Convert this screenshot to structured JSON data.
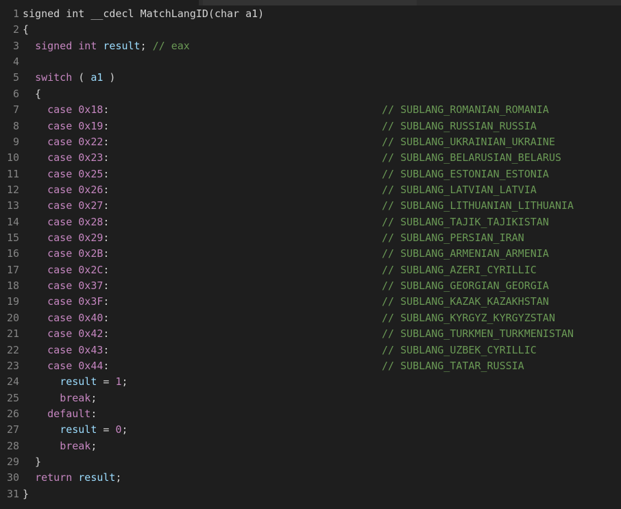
{
  "editor": {
    "lines": [
      {
        "n": "1",
        "code": "signed int __cdecl MatchLangID(char a1)",
        "comment": ""
      },
      {
        "n": "2",
        "code": "{",
        "comment": ""
      },
      {
        "n": "3",
        "code": "  signed int result; // eax",
        "comment": ""
      },
      {
        "n": "4",
        "code": "",
        "comment": ""
      },
      {
        "n": "5",
        "code": "  switch ( a1 )",
        "comment": ""
      },
      {
        "n": "6",
        "code": "  {",
        "comment": ""
      },
      {
        "n": "7",
        "code": "    case 0x18:",
        "comment": "// SUBLANG_ROMANIAN_ROMANIA"
      },
      {
        "n": "8",
        "code": "    case 0x19:",
        "comment": "// SUBLANG_RUSSIAN_RUSSIA"
      },
      {
        "n": "9",
        "code": "    case 0x22:",
        "comment": "// SUBLANG_UKRAINIAN_UKRAINE"
      },
      {
        "n": "10",
        "code": "    case 0x23:",
        "comment": "// SUBLANG_BELARUSIAN_BELARUS"
      },
      {
        "n": "11",
        "code": "    case 0x25:",
        "comment": "// SUBLANG_ESTONIAN_ESTONIA"
      },
      {
        "n": "12",
        "code": "    case 0x26:",
        "comment": "// SUBLANG_LATVIAN_LATVIA"
      },
      {
        "n": "13",
        "code": "    case 0x27:",
        "comment": "// SUBLANG_LITHUANIAN_LITHUANIA"
      },
      {
        "n": "14",
        "code": "    case 0x28:",
        "comment": "// SUBLANG_TAJIK_TAJIKISTAN"
      },
      {
        "n": "15",
        "code": "    case 0x29:",
        "comment": "// SUBLANG_PERSIAN_IRAN"
      },
      {
        "n": "16",
        "code": "    case 0x2B:",
        "comment": "// SUBLANG_ARMENIAN_ARMENIA"
      },
      {
        "n": "17",
        "code": "    case 0x2C:",
        "comment": "// SUBLANG_AZERI_CYRILLIC"
      },
      {
        "n": "18",
        "code": "    case 0x37:",
        "comment": "// SUBLANG_GEORGIAN_GEORGIA"
      },
      {
        "n": "19",
        "code": "    case 0x3F:",
        "comment": "// SUBLANG_KAZAK_KAZAKHSTAN"
      },
      {
        "n": "20",
        "code": "    case 0x40:",
        "comment": "// SUBLANG_KYRGYZ_KYRGYZSTAN"
      },
      {
        "n": "21",
        "code": "    case 0x42:",
        "comment": "// SUBLANG_TURKMEN_TURKMENISTAN"
      },
      {
        "n": "22",
        "code": "    case 0x43:",
        "comment": "// SUBLANG_UZBEK_CYRILLIC"
      },
      {
        "n": "23",
        "code": "    case 0x44:",
        "comment": "// SUBLANG_TATAR_RUSSIA"
      },
      {
        "n": "24",
        "code": "      result = 1;",
        "comment": ""
      },
      {
        "n": "25",
        "code": "      break;",
        "comment": ""
      },
      {
        "n": "26",
        "code": "    default:",
        "comment": ""
      },
      {
        "n": "27",
        "code": "      result = 0;",
        "comment": ""
      },
      {
        "n": "28",
        "code": "      break;",
        "comment": ""
      },
      {
        "n": "29",
        "code": "  }",
        "comment": ""
      },
      {
        "n": "30",
        "code": "  return result;",
        "comment": ""
      },
      {
        "n": "31",
        "code": "}",
        "comment": ""
      }
    ]
  },
  "colors": {
    "background": "#1e1e1e",
    "line_number": "#858585",
    "keyword": "#c586c0",
    "variable": "#9cdcfe",
    "comment": "#6a9955",
    "text": "#d4d4d4"
  }
}
